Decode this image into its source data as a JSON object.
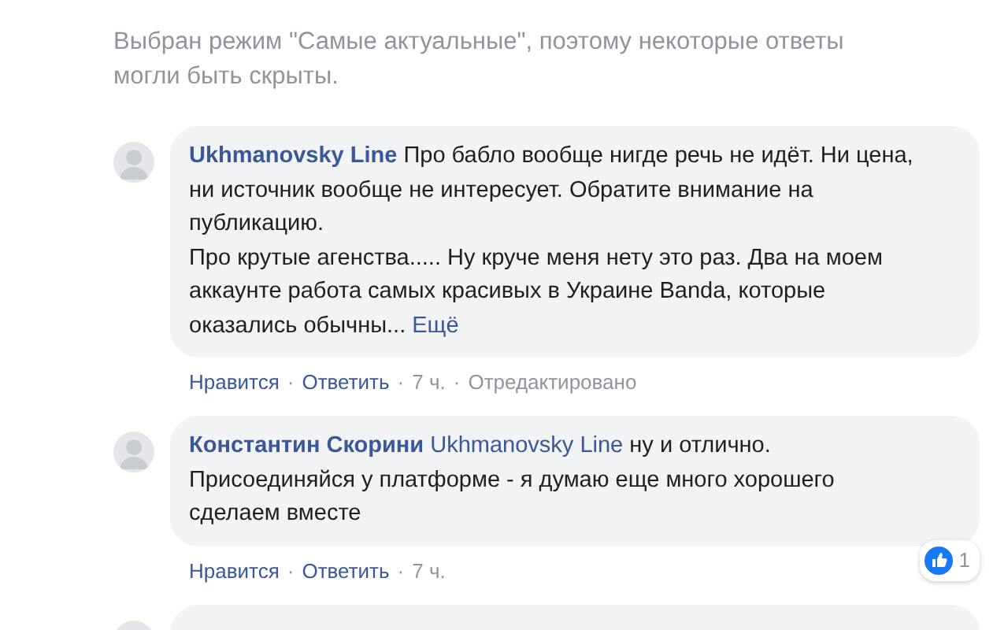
{
  "notice": "Выбран режим \"Самые актуальные\", поэтому некоторые ответы могли быть скрыты.",
  "separator": "·",
  "comments": [
    {
      "author": "Ukhmanovsky Line",
      "text": "Про бабло вообще нигде речь не идёт. Ни цена, ни источник вообще не интересует. Обратите внимание на публикацию.\nПро крутые агенства..... Ну круче меня нету это раз. Два на моем аккаунте работа самых красивых в Украине Banda, которые оказались обычны...",
      "more": "Ещё",
      "actions": [
        {
          "text": "Нравится",
          "kind": "link"
        },
        {
          "text": "Ответить",
          "kind": "link"
        },
        {
          "text": "7 ч.",
          "kind": "meta"
        },
        {
          "text": "Отредактировано",
          "kind": "meta"
        }
      ]
    },
    {
      "author": "Константин Скорини",
      "mention": "Ukhmanovsky Line",
      "text": "ну и отлично. Присоединяйся у платформе - я думаю еще много хорошего сделаем вместе",
      "actions": [
        {
          "text": "Нравится",
          "kind": "link"
        },
        {
          "text": "Ответить",
          "kind": "link"
        },
        {
          "text": "7 ч.",
          "kind": "meta"
        }
      ],
      "reactions": "1"
    }
  ]
}
